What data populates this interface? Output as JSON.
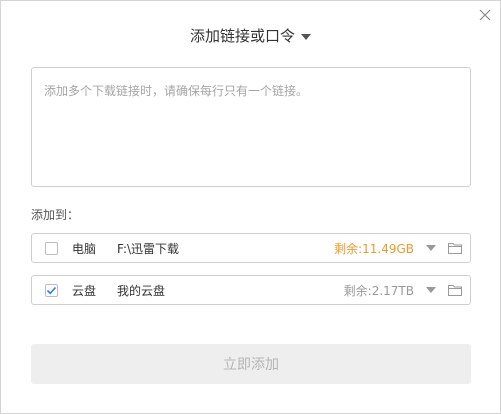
{
  "dialog": {
    "title": "添加链接或口令",
    "textarea_placeholder": "添加多个下载链接时，请确保每行只有一个链接。",
    "addto_label": "添加到：",
    "destinations": [
      {
        "name": "电脑",
        "path": "F:\\迅雷下载",
        "free": "剩余:11.49GB",
        "checked": false,
        "free_color": "#f19a27"
      },
      {
        "name": "云盘",
        "path": "我的云盘",
        "free": "剩余:2.17TB",
        "checked": true,
        "free_color": "#999999"
      }
    ],
    "submit_label": "立即添加"
  },
  "icons": {
    "close": "close-icon",
    "title_caret": "caret-down-icon",
    "checkbox_checked": "check-icon",
    "dropdown": "chevron-down-icon",
    "folder": "folder-icon"
  },
  "colors": {
    "accent_check": "#2f7ff0",
    "warn": "#f19a27",
    "disabled_button_bg": "#eeeeee"
  }
}
